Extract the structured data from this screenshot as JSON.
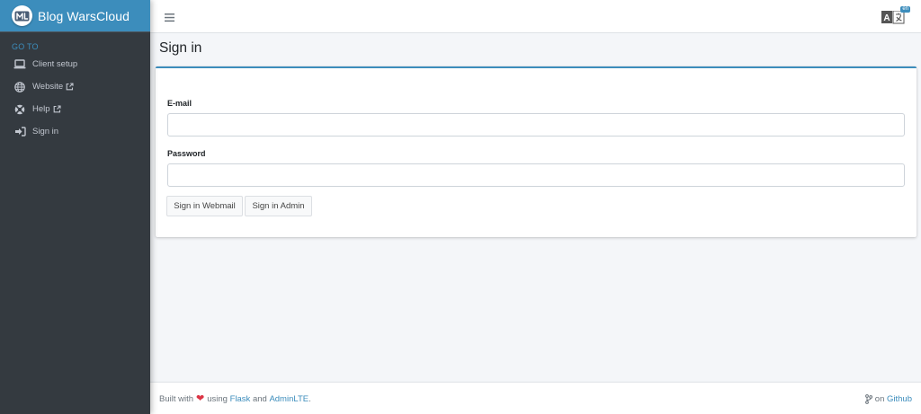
{
  "sidebar": {
    "brand": "Blog WarsCloud",
    "section_header": "GO TO",
    "items": [
      {
        "label": "Client setup",
        "icon": "laptop-icon",
        "external": false
      },
      {
        "label": "Website",
        "icon": "globe-icon",
        "external": true
      },
      {
        "label": "Help",
        "icon": "lifebuoy-icon",
        "external": true
      },
      {
        "label": "Sign in",
        "icon": "sign-in-icon",
        "external": false
      }
    ]
  },
  "topbar": {
    "menu_icon": "hamburger-icon",
    "language_icon": "translate-icon",
    "language_badge": "en"
  },
  "page": {
    "title": "Sign in"
  },
  "form": {
    "email_label": "E-mail",
    "email_value": "",
    "password_label": "Password",
    "password_value": "",
    "webmail_button": "Sign in Webmail",
    "admin_button": "Sign in Admin"
  },
  "footer": {
    "built_with": "Built with",
    "using": "using",
    "flask": "Flask",
    "and": "and",
    "adminlte": "AdminLTE",
    "period": ".",
    "on": "on",
    "github": "Github"
  },
  "colors": {
    "brand": "#3c8dbc",
    "sidebar_bg": "#343a40",
    "heart": "#dc3545"
  }
}
